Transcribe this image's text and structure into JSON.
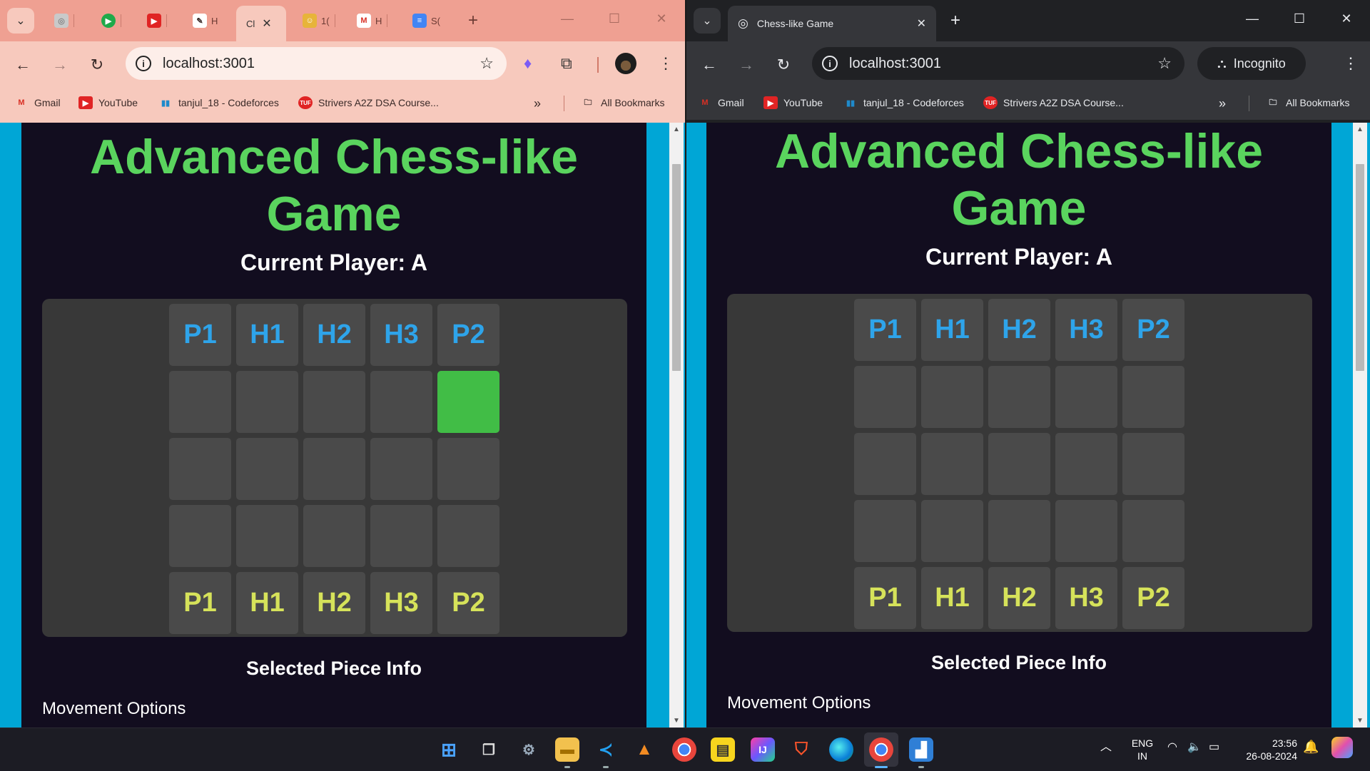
{
  "left_window": {
    "tabs": [
      {
        "label": "H",
        "favicon": "youtube-icon"
      },
      {
        "label": "Cl",
        "active": true
      },
      {
        "label": "1("
      },
      {
        "label": "H",
        "favicon": "gmail-icon"
      },
      {
        "label": "S(",
        "favicon": "docs-icon"
      }
    ],
    "url": "localhost:3001"
  },
  "right_window": {
    "tab_title": "Chess-like Game",
    "url": "localhost:3001",
    "incognito_label": "Incognito"
  },
  "bookmarks": {
    "items": [
      "Gmail",
      "YouTube",
      "tanjul_18 - Codeforces",
      "Strivers A2Z DSA Course..."
    ],
    "all_bookmarks": "All Bookmarks",
    "overflow": "»"
  },
  "game": {
    "title": "Advanced Chess-like Game",
    "current_player_label": "Current Player: A",
    "top_row": [
      "P1",
      "H1",
      "H2",
      "H3",
      "P2"
    ],
    "bottom_row": [
      "P1",
      "H1",
      "H2",
      "H3",
      "P2"
    ],
    "selected_piece_info": "Selected Piece Info",
    "movement_options": "Movement Options"
  },
  "highlighted_cell_left": {
    "row": 2,
    "col": 5
  },
  "colors": {
    "title_green": "#5ad45e",
    "player_a_blue": "#2ea4ea",
    "player_b_yellow": "#d6e25a",
    "highlight_green": "#41bd46",
    "page_bg": "#120d1f",
    "board_bg": "#383838",
    "cell_bg": "#4a4a4a"
  },
  "taskbar": {
    "language": "ENG",
    "region": "IN",
    "time": "23:56",
    "date": "26-08-2024"
  }
}
